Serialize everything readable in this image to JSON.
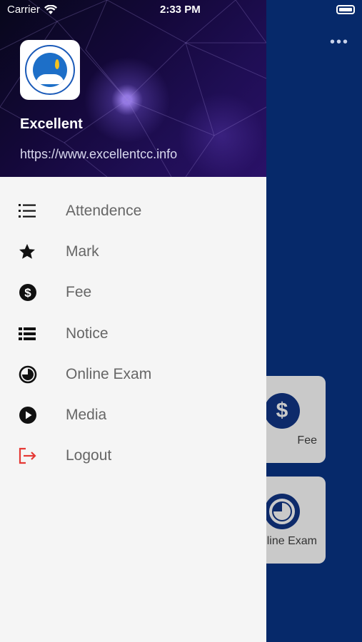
{
  "status_bar": {
    "carrier": "Carrier",
    "time": "2:33 PM"
  },
  "background": {
    "more_icon": "ellipsis-icon",
    "cards": [
      {
        "label": "Fee",
        "icon": "dollar-circle-icon"
      },
      {
        "label": "line Exam",
        "icon": "clock-circle-icon"
      }
    ]
  },
  "drawer": {
    "header": {
      "title": "Excellent",
      "url": "https://www.excellentcc.info"
    },
    "items": [
      {
        "label": "Attendence",
        "icon": "list-numbered-icon"
      },
      {
        "label": "Mark",
        "icon": "star-icon"
      },
      {
        "label": "Fee",
        "icon": "dollar-circle-icon"
      },
      {
        "label": "Notice",
        "icon": "list-icon"
      },
      {
        "label": "Online Exam",
        "icon": "timer-icon"
      },
      {
        "label": "Media",
        "icon": "play-circle-icon"
      },
      {
        "label": "Logout",
        "icon": "logout-icon"
      }
    ]
  },
  "colors": {
    "drawer_bg": "#f5f5f5",
    "background_blue": "#06296a",
    "logout_red": "#e53935",
    "menu_text": "#666666"
  }
}
